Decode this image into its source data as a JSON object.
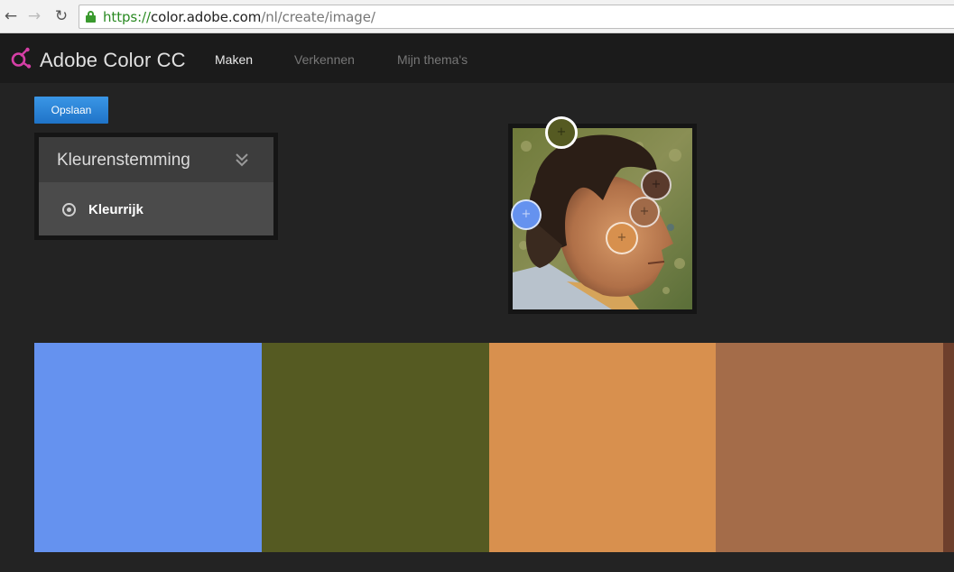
{
  "browser": {
    "url_protocol": "https://",
    "url_host": "color.adobe.com",
    "url_path": "/nl/create/image/",
    "back_icon": "arrow-left-icon",
    "forward_icon": "arrow-right-icon",
    "reload_icon": "reload-icon",
    "lock_icon": "lock-icon"
  },
  "app": {
    "title": "Adobe Color CC",
    "logo_icon": "adobe-color-logo-icon",
    "tabs": [
      {
        "label": "Maken",
        "active": true
      },
      {
        "label": "Verkennen",
        "active": false
      },
      {
        "label": "Mijn thema's",
        "active": false
      }
    ]
  },
  "toolbar": {
    "save_label": "Opslaan"
  },
  "mood": {
    "title": "Kleurenstemming",
    "chevron_icon": "double-chevron-down-icon",
    "selected_option": "Kleurrijk"
  },
  "pickers": [
    {
      "name": "olive",
      "color": "#555a22"
    },
    {
      "name": "blue",
      "color": "#6592ef"
    },
    {
      "name": "dark-brown",
      "color": "#5a3a2c"
    },
    {
      "name": "brown",
      "color": "#a06a48"
    },
    {
      "name": "orange",
      "color": "#d7904e"
    }
  ],
  "swatches": [
    {
      "color": "#6592ef"
    },
    {
      "color": "#555a22"
    },
    {
      "color": "#d8904e"
    },
    {
      "color": "#a46c49"
    },
    {
      "color": "#6e3f2c"
    }
  ]
}
